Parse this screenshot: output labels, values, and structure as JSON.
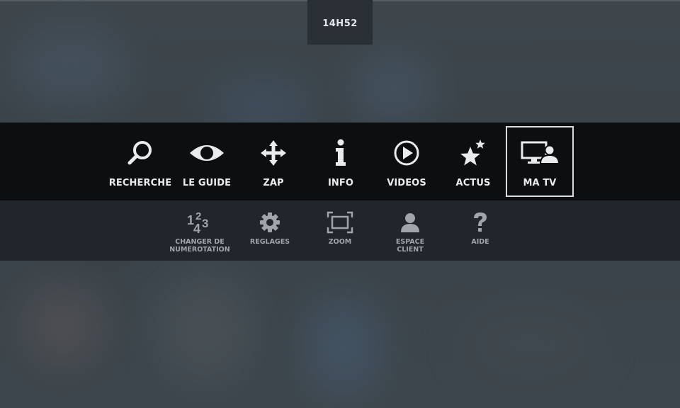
{
  "clock": {
    "time": "14H52"
  },
  "main_menu": {
    "items": [
      {
        "id": "recherche",
        "label": "RECHERCHE",
        "icon": "search-icon"
      },
      {
        "id": "le-guide",
        "label": "LE GUIDE",
        "icon": "eye-icon"
      },
      {
        "id": "zap",
        "label": "ZAP",
        "icon": "move-arrows-icon"
      },
      {
        "id": "info",
        "label": "INFO",
        "icon": "info-icon"
      },
      {
        "id": "videos",
        "label": "VIDEOS",
        "icon": "play-circle-icon"
      },
      {
        "id": "actus",
        "label": "ACTUS",
        "icon": "stars-icon"
      },
      {
        "id": "ma-tv",
        "label": "MA TV",
        "icon": "tv-user-icon",
        "selected": true
      }
    ]
  },
  "sub_menu": {
    "items": [
      {
        "id": "changer-numerotation",
        "label_line1": "CHANGER DE",
        "label_line2": "NUMEROTATION",
        "icon": "numbers-icon",
        "icon_glyphs": [
          "1",
          "2",
          "4",
          "3"
        ]
      },
      {
        "id": "reglages",
        "label_line1": "REGLAGES",
        "label_line2": "",
        "icon": "gear-icon"
      },
      {
        "id": "zoom",
        "label_line1": "ZOOM",
        "label_line2": "",
        "icon": "zoom-frame-icon"
      },
      {
        "id": "espace-client",
        "label_line1": "ESPACE",
        "label_line2": "CLIENT",
        "icon": "user-icon"
      },
      {
        "id": "aide",
        "label_line1": "AIDE",
        "label_line2": "",
        "icon": "question-icon"
      }
    ]
  },
  "colors": {
    "main_bar": "#0c0e10",
    "sub_bar": "#20262b",
    "main_text": "#e9ebec",
    "sub_text": "#9fa5aa",
    "selection_border": "#d9dbdd"
  }
}
